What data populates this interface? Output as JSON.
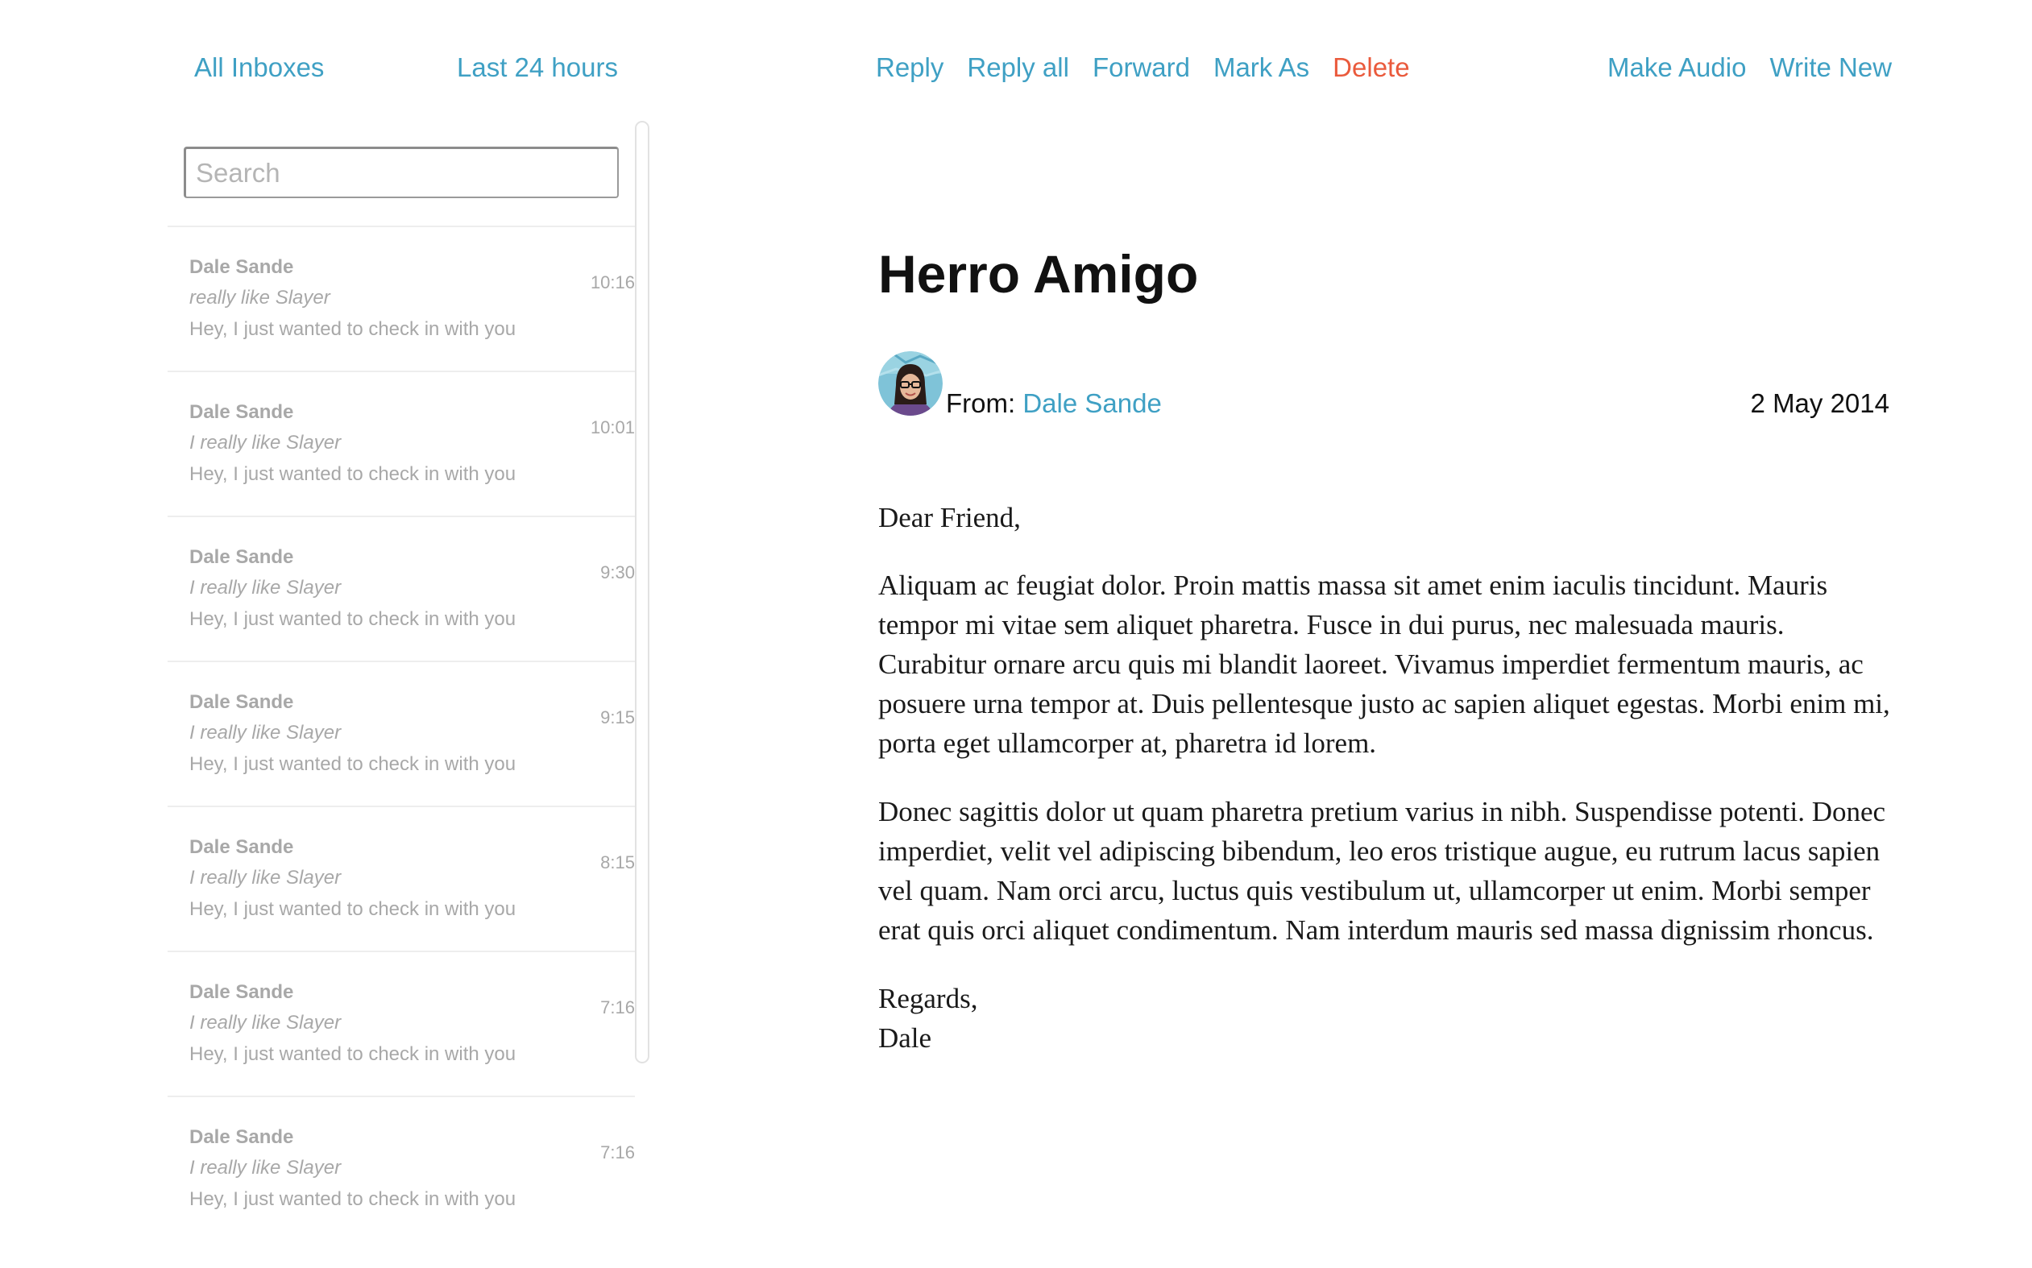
{
  "nav": {
    "all_inboxes": "All Inboxes",
    "last_24_hours": "Last 24 hours",
    "reply": "Reply",
    "reply_all": "Reply all",
    "forward": "Forward",
    "mark_as": "Mark As",
    "delete": "Delete",
    "make_audio": "Make Audio",
    "write_new": "Write New"
  },
  "search": {
    "placeholder": "Search",
    "value": ""
  },
  "messages": [
    {
      "from": "Dale Sande",
      "subject": "really like Slayer",
      "snippet": "Hey, I just wanted to check in with you",
      "time": "10:16"
    },
    {
      "from": "Dale Sande",
      "subject": "I really like Slayer",
      "snippet": "Hey, I just wanted to check in with you",
      "time": "10:01"
    },
    {
      "from": "Dale Sande",
      "subject": "I really like Slayer",
      "snippet": "Hey, I just wanted to check in with you",
      "time": "9:30"
    },
    {
      "from": "Dale Sande",
      "subject": "I really like Slayer",
      "snippet": "Hey, I just wanted to check in with you",
      "time": "9:15"
    },
    {
      "from": "Dale Sande",
      "subject": "I really like Slayer",
      "snippet": "Hey, I just wanted to check in with you",
      "time": "8:15"
    },
    {
      "from": "Dale Sande",
      "subject": "I really like Slayer",
      "snippet": "Hey, I just wanted to check in with you",
      "time": "7:16"
    },
    {
      "from": "Dale Sande",
      "subject": "I really like Slayer",
      "snippet": "Hey, I just wanted to check in with you",
      "time": "7:16"
    }
  ],
  "reader": {
    "title": "Herro Amigo",
    "from_label": "From:",
    "from_name": "Dale Sande",
    "date": "2 May 2014",
    "greeting": "Dear Friend,",
    "paragraphs": [
      "Aliquam ac feugiat dolor. Proin mattis massa sit amet enim iaculis tincidunt. Mauris tempor mi vitae sem aliquet pharetra. Fusce in dui purus, nec malesuada mauris. Curabitur ornare arcu quis mi blandit laoreet. Vivamus imperdiet fermentum mauris, ac posuere urna tempor at. Duis pellentesque justo ac sapien aliquet egestas. Morbi enim mi, porta eget ullamcorper at, pharetra id lorem.",
      "Donec sagittis dolor ut quam pharetra pretium varius in nibh. Suspendisse potenti. Donec imperdiet, velit vel adipiscing bibendum, leo eros tristique augue, eu rutrum lacus sapien vel quam. Nam orci arcu, luctus quis vestibulum ut, ullamcorper ut enim. Morbi semper erat quis orci aliquet condimentum. Nam interdum mauris sed massa dignissim rhoncus."
    ],
    "signoff": "Regards,",
    "signature": "Dale"
  },
  "colors": {
    "link": "#3fa0c4",
    "delete": "#ea5a3c",
    "muted_text": "#a8a8a8"
  }
}
